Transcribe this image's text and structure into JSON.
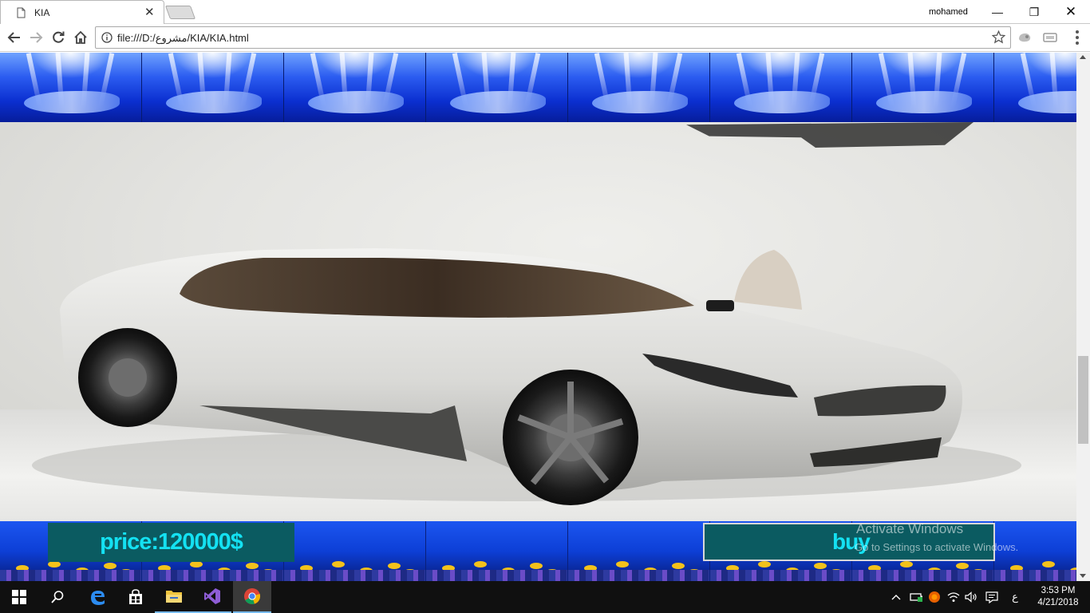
{
  "browser": {
    "tab": {
      "title": "KIA",
      "close_glyph": "✕",
      "icon": "page-icon"
    },
    "profile_name": "mohamed",
    "window_controls": {
      "minimize": "—",
      "restore": "❐",
      "close": "✕"
    },
    "toolbar": {
      "back_icon": "arrow-left-icon",
      "forward_icon": "arrow-right-icon",
      "reload_icon": "reload-icon",
      "home_icon": "home-icon",
      "url": "file:///D:/مشروع/KIA/KIA.html",
      "bookmark_icon": "star-icon"
    }
  },
  "page": {
    "price_label": "price:120000$",
    "buy_label": "buy",
    "hero_image": "white-kia-concept-car",
    "banner_top_image": "underwater-whale-tile",
    "banner_bottom_image": "underwater-fish-tile",
    "colors": {
      "box_bg": "#0b5b61",
      "box_text": "#14e1f2",
      "banner_blue": "#0a2fc8"
    }
  },
  "watermark": {
    "line1": "Activate Windows",
    "line2": "Go to Settings to activate Windows."
  },
  "taskbar": {
    "apps": [
      "start",
      "search",
      "edge",
      "store",
      "file-explorer",
      "visual-studio",
      "chrome"
    ],
    "language": "ع",
    "time": "3:53 PM",
    "date": "4/21/2018"
  }
}
